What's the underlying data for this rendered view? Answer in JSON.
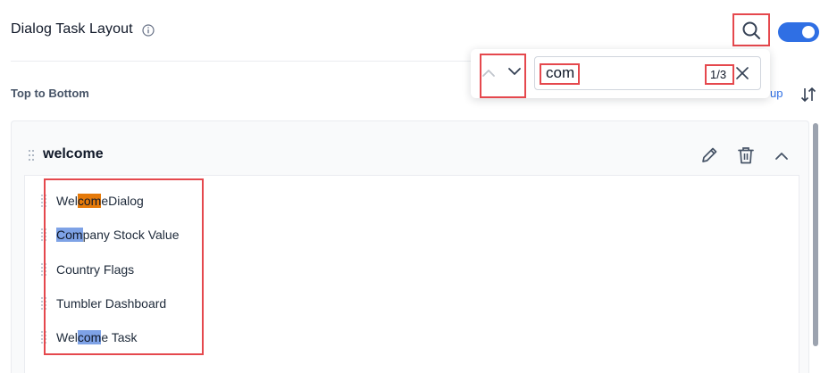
{
  "header": {
    "title": "Dialog Task Layout",
    "info_icon": "info-circle-icon",
    "search_icon": "search-icon",
    "toggle_state": "on",
    "toggle_color": "#2f6fe4"
  },
  "layout_bar": {
    "order_label": "Top to Bottom",
    "partial_link": "up",
    "sort_icon": "sort-arrows-icon"
  },
  "search_popover": {
    "query": "com",
    "match_counter": "1/3",
    "prev_icon": "chevron-up-icon",
    "next_icon": "chevron-down-icon",
    "clear_icon": "close-icon"
  },
  "group": {
    "title": "welcome",
    "actions": [
      "edit-icon",
      "trash-icon",
      "chevron-up-icon"
    ],
    "items": [
      {
        "pre": "Wel",
        "match": "com",
        "post": "eDialog",
        "highlight": "current"
      },
      {
        "pre": "",
        "match": "Com",
        "post": "pany Stock Value",
        "highlight": "match"
      },
      {
        "pre": "Country Flags",
        "match": "",
        "post": "",
        "highlight": "none"
      },
      {
        "pre": "Tumbler Dashboard",
        "match": "",
        "post": "",
        "highlight": "none"
      },
      {
        "pre": "Wel",
        "match": "com",
        "post": "e Task",
        "highlight": "match"
      }
    ]
  },
  "colors": {
    "accent": "#2f6fe4",
    "annotation_red": "#e5484d",
    "current_highlight": "#e57a0a",
    "match_highlight": "#7ea2e6"
  }
}
